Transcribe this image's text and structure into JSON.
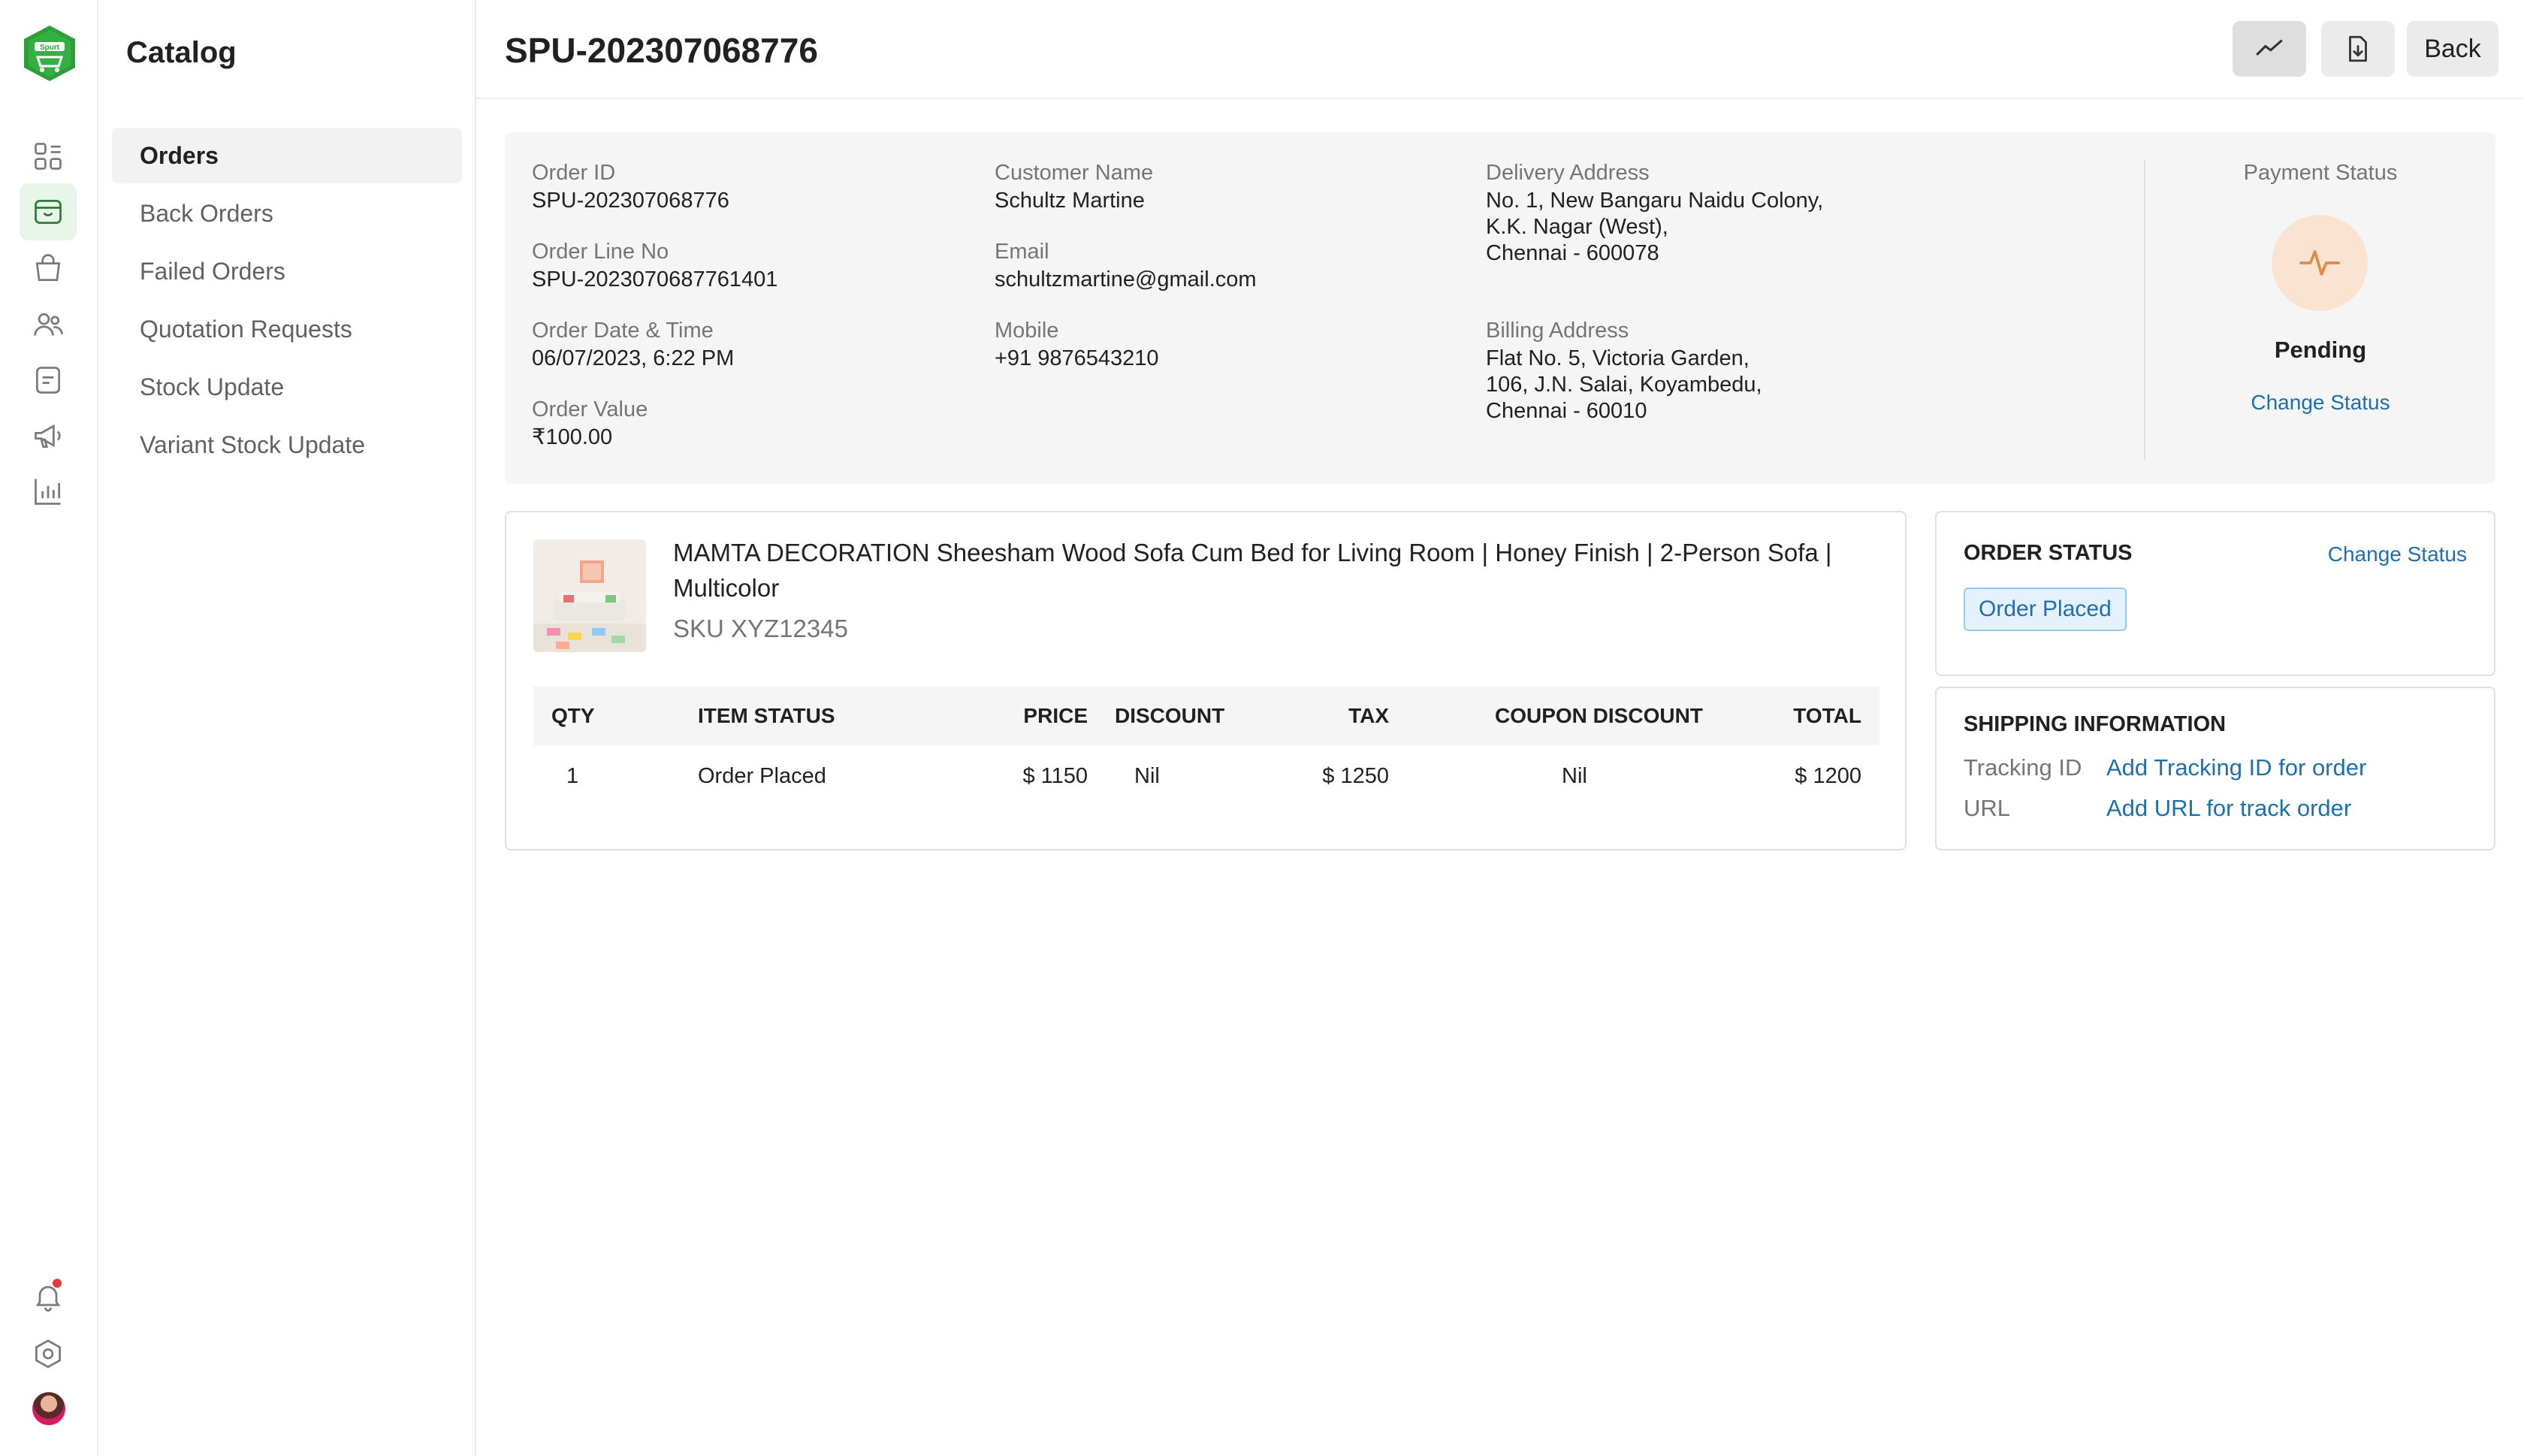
{
  "logo_text": "Spurt",
  "rail": {
    "items": [
      {
        "icon": "dashboard-icon"
      },
      {
        "icon": "catalog-icon",
        "active": true
      },
      {
        "icon": "shopping-bag-icon"
      },
      {
        "icon": "users-icon"
      },
      {
        "icon": "document-icon"
      },
      {
        "icon": "megaphone-icon"
      },
      {
        "icon": "reports-icon"
      }
    ],
    "bottom": [
      {
        "icon": "bell-icon"
      },
      {
        "icon": "settings-icon"
      },
      {
        "icon": "avatar"
      }
    ]
  },
  "catalog": {
    "title": "Catalog",
    "items": [
      {
        "label": "Orders",
        "active": true
      },
      {
        "label": "Back Orders"
      },
      {
        "label": "Failed Orders"
      },
      {
        "label": "Quotation Requests"
      },
      {
        "label": "Stock Update"
      },
      {
        "label": "Variant Stock Update"
      }
    ]
  },
  "header": {
    "title": "SPU-202307068776",
    "back_label": "Back"
  },
  "summary": {
    "order_id_label": "Order ID",
    "order_id": "SPU-202307068776",
    "line_no_label": "Order Line No",
    "line_no": "SPU-2023070687761401",
    "datetime_label": "Order Date & Time",
    "datetime": "06/07/2023, 6:22 PM",
    "value_label": "Order Value",
    "value": "₹100.00",
    "customer_label": "Customer Name",
    "customer": "Schultz Martine",
    "email_label": "Email",
    "email": "schultzmartine@gmail.com",
    "mobile_label": "Mobile",
    "mobile": "+91 9876543210",
    "delivery_label": "Delivery Address",
    "delivery_lines": [
      "No. 1, New Bangaru Naidu Colony,",
      "K.K. Nagar (West),",
      "Chennai - 600078"
    ],
    "billing_label": "Billing Address",
    "billing_lines": [
      "Flat No. 5, Victoria Garden,",
      "106, J.N. Salai, Koyambedu,",
      "Chennai - 60010"
    ],
    "payment_status_label": "Payment Status",
    "payment_status": "Pending",
    "change_status": "Change Status"
  },
  "product": {
    "title": "MAMTA DECORATION Sheesham Wood Sofa Cum Bed for Living Room | Honey Finish | 2-Person Sofa | Multicolor",
    "sku": "SKU XYZ12345",
    "columns": [
      "QTY",
      "ITEM STATUS",
      "PRICE",
      "DISCOUNT",
      "TAX",
      "COUPON DISCOUNT",
      "TOTAL"
    ],
    "row": [
      "1",
      "Order Placed",
      "$ 1150",
      "Nil",
      "$ 1250",
      "Nil",
      "$ 1200"
    ]
  },
  "order_status": {
    "heading": "ORDER STATUS",
    "change_status": "Change Status",
    "badge": "Order Placed",
    "badge_color": "#1e6fb0"
  },
  "shipping": {
    "heading": "SHIPPING INFORMATION",
    "tracking_label": "Tracking ID",
    "tracking_value": "Add Tracking ID for order",
    "url_label": "URL",
    "url_value": "Add URL for track order"
  },
  "colors": {
    "accent": "#2e7d32",
    "link": "#1e6fb0",
    "pending": "#e08a4a"
  }
}
